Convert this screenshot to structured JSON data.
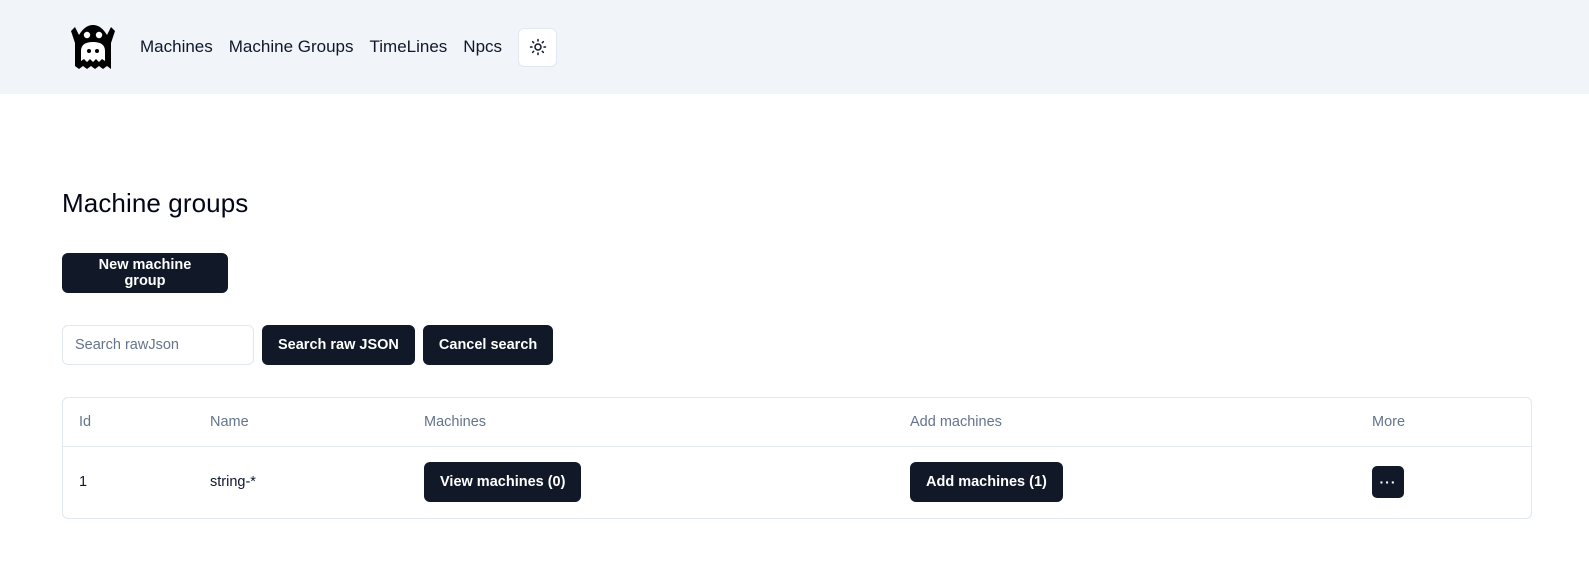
{
  "nav": {
    "logo_icon": "ghost-logo-icon",
    "links": [
      "Machines",
      "Machine Groups",
      "TimeLines",
      "Npcs"
    ],
    "theme_toggle_icon": "sun-icon"
  },
  "page": {
    "title": "Machine groups",
    "new_button_label": "New machine group"
  },
  "search": {
    "placeholder": "Search rawJson",
    "value": "",
    "search_button_label": "Search raw JSON",
    "cancel_button_label": "Cancel search"
  },
  "table": {
    "headers": [
      "Id",
      "Name",
      "Machines",
      "Add machines",
      "More"
    ],
    "rows": [
      {
        "id": "1",
        "name": "string-*",
        "view_machines_label": "View machines (0)",
        "add_machines_label": "Add machines (1)",
        "more_label": "···"
      }
    ]
  },
  "colors": {
    "navbar_bg": "#f1f5f9",
    "button_bg": "#111827",
    "header_text": "#64748b",
    "border": "#e2e8f0"
  }
}
